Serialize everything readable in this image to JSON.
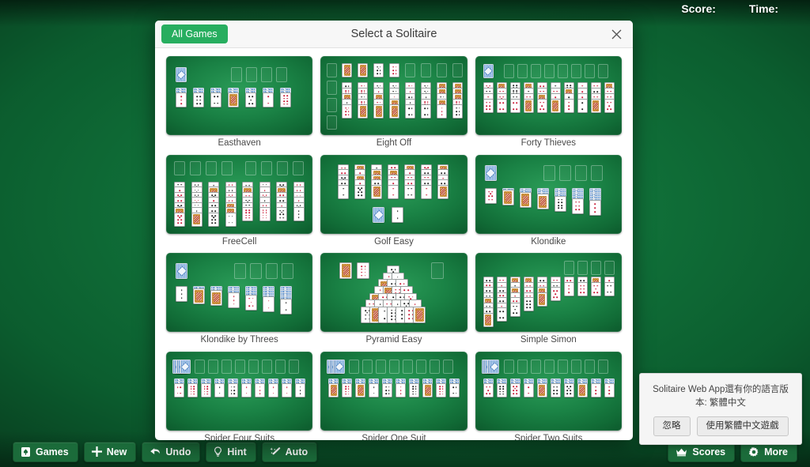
{
  "statusbar": {
    "score_label": "Score:",
    "time_label": "Time:"
  },
  "modal": {
    "all_games_label": "All Games",
    "title": "Select a Solitaire",
    "close_icon": "close-icon",
    "games": [
      {
        "name": "Easthaven",
        "layout": "easthaven"
      },
      {
        "name": "Eight Off",
        "layout": "eightoff"
      },
      {
        "name": "Forty Thieves",
        "layout": "fortythieves"
      },
      {
        "name": "FreeCell",
        "layout": "freecell"
      },
      {
        "name": "Golf Easy",
        "layout": "golf"
      },
      {
        "name": "Klondike",
        "layout": "klondike"
      },
      {
        "name": "Klondike by Threes",
        "layout": "klondike3"
      },
      {
        "name": "Pyramid Easy",
        "layout": "pyramid"
      },
      {
        "name": "Simple Simon",
        "layout": "simplesimon"
      },
      {
        "name": "Spider Four Suits",
        "layout": "spider"
      },
      {
        "name": "Spider One Suit",
        "layout": "spider"
      },
      {
        "name": "Spider Two Suits",
        "layout": "spider"
      }
    ]
  },
  "toast": {
    "message": "Solitaire Web App還有你的語言版本: 繁體中文",
    "dismiss_label": "忽略",
    "accept_label": "使用繁體中文遊戲"
  },
  "toolbar_left": [
    {
      "label": "Games",
      "icon": "card-icon"
    },
    {
      "label": "New",
      "icon": "plus-icon"
    },
    {
      "label": "Undo",
      "icon": "undo-arrow-icon"
    },
    {
      "label": "Hint",
      "icon": "lightbulb-icon"
    },
    {
      "label": "Auto",
      "icon": "magic-wand-icon"
    }
  ],
  "toolbar_right": [
    {
      "label": "Scores",
      "icon": "crown-icon"
    },
    {
      "label": "More",
      "icon": "gear-icon"
    }
  ],
  "colors": {
    "felt_green": "#0d6a35",
    "accent_green": "#27ae5f",
    "toolbar_green": "#1b6b3a",
    "card_red": "#c8102e",
    "card_black": "#1b1b1b"
  }
}
